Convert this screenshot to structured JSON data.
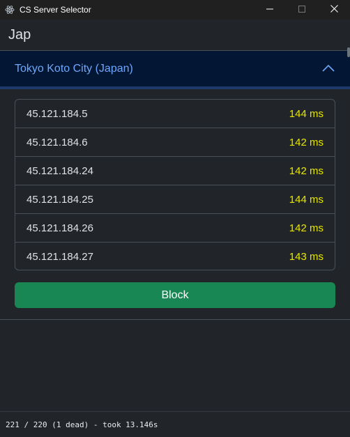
{
  "window": {
    "title": "CS Server Selector"
  },
  "group": {
    "name": "Jap"
  },
  "accordion": {
    "title": "Tokyo Koto City (Japan)",
    "expanded": true
  },
  "servers": [
    {
      "ip": "45.121.184.5",
      "ping": "144 ms"
    },
    {
      "ip": "45.121.184.6",
      "ping": "142 ms"
    },
    {
      "ip": "45.121.184.24",
      "ping": "142 ms"
    },
    {
      "ip": "45.121.184.25",
      "ping": "144 ms"
    },
    {
      "ip": "45.121.184.26",
      "ping": "142 ms"
    },
    {
      "ip": "45.121.184.27",
      "ping": "143 ms"
    }
  ],
  "actions": {
    "block_label": "Block"
  },
  "status": {
    "text": "221 / 220 (1 dead) - took 13.146s"
  },
  "colors": {
    "background": "#212529",
    "accordion_header_bg": "#031633",
    "accordion_title": "#6ea8fe",
    "ping_text": "#e6e600",
    "block_button": "#198754"
  },
  "icons": {
    "app": "electron-atom-icon",
    "minimize": "minimize-icon",
    "maximize": "maximize-icon",
    "close": "close-icon",
    "chevron": "chevron-up-icon"
  }
}
